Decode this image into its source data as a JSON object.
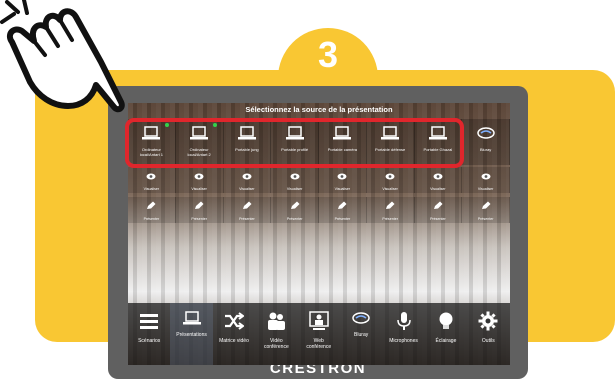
{
  "step": {
    "number": "3"
  },
  "screen": {
    "title": "Sélectionnez la source de la présentation",
    "sources": [
      {
        "label": "Ordinateur\nlocal/Antart 1",
        "connected": true
      },
      {
        "label": "Ordinateur\nlocal/Antart 2",
        "connected": true
      },
      {
        "label": "Portable jung",
        "connected": false
      },
      {
        "label": "Portable profilé",
        "connected": false
      },
      {
        "label": "Portable caméra",
        "connected": false
      },
      {
        "label": "Portable défense",
        "connected": false
      },
      {
        "label": "Portable Ghazal",
        "connected": false
      },
      {
        "label": "Bluray",
        "connected": false,
        "icon": "bluray-icon"
      }
    ],
    "preview_row": {
      "label": "Visualiser"
    },
    "present_row": {
      "label": "Présenter"
    },
    "nav": [
      {
        "label": "Scénarios",
        "icon": "menu-icon"
      },
      {
        "label": "Présentations",
        "icon": "laptop-icon",
        "active": true
      },
      {
        "label": "Matrice vidéo",
        "icon": "shuffle-icon"
      },
      {
        "label": "Vidéo\nconférence",
        "icon": "people-icon"
      },
      {
        "label": "Web\nconférence",
        "icon": "webconf-icon"
      },
      {
        "label": "Bluray",
        "icon": "bluray-icon"
      },
      {
        "label": "Microphones",
        "icon": "microphone-icon"
      },
      {
        "label": "Éclairage",
        "icon": "bulb-icon"
      },
      {
        "label": "Outils",
        "icon": "gear-icon"
      }
    ]
  },
  "device": {
    "brand": "CRESTRON"
  },
  "colors": {
    "card": "#f9c733",
    "highlight": "#e0262c",
    "tablet": "#606060"
  }
}
